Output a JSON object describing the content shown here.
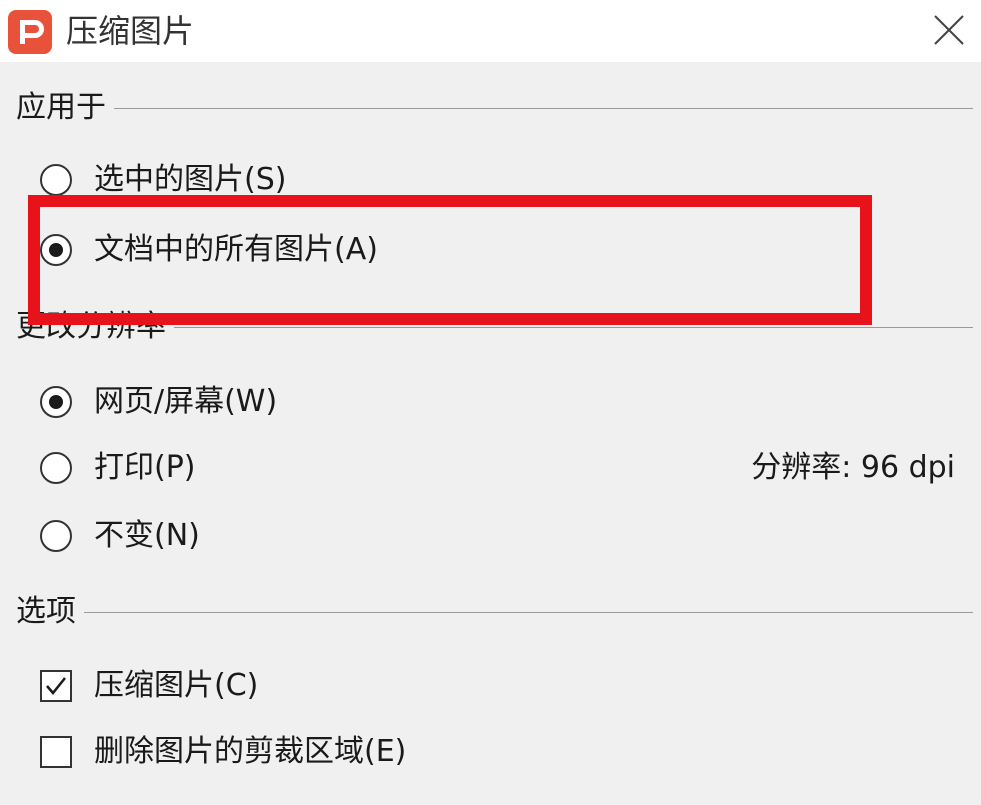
{
  "window": {
    "title": "压缩图片",
    "app_icon": "wps-presentation-icon",
    "close_icon": "close-icon"
  },
  "apply_to": {
    "label": "应用于",
    "options": [
      {
        "label": "选中的图片(S)",
        "selected": false
      },
      {
        "label": "文档中的所有图片(A)",
        "selected": true
      }
    ]
  },
  "change_resolution": {
    "label": "更改分辨率",
    "options": [
      {
        "label": "网页/屏幕(W)",
        "selected": true
      },
      {
        "label": "打印(P)",
        "selected": false
      },
      {
        "label": "不变(N)",
        "selected": false
      }
    ],
    "resolution_text": "分辨率:  96 dpi"
  },
  "options_group": {
    "label": "选项",
    "items": [
      {
        "label": "压缩图片(C)",
        "checked": true
      },
      {
        "label": "删除图片的剪裁区域(E)",
        "checked": false
      }
    ]
  },
  "colors": {
    "highlight": "#e8121a",
    "app_icon_bg": "#e8523a",
    "dialog_bg": "#f0f0f0"
  }
}
